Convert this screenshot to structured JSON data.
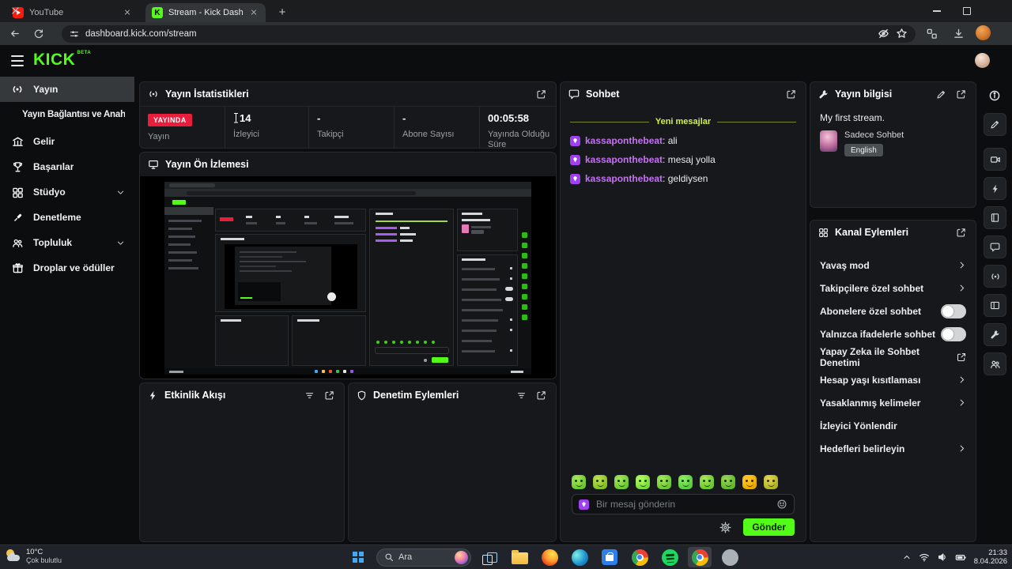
{
  "browser": {
    "tabs": [
      {
        "title": "YouTube"
      },
      {
        "title": "Stream - Kick Dashboard",
        "favicon_text": "K"
      }
    ],
    "new_tab_label": "+",
    "url": "dashboard.kick.com/stream"
  },
  "header": {
    "logo": "KICK",
    "beta": "BETA"
  },
  "sidebar": {
    "items": [
      {
        "label": "Yayın"
      },
      {
        "label": "Yayın Bağlantısı ve Anahtarı"
      },
      {
        "label": "Gelir"
      },
      {
        "label": "Başarılar"
      },
      {
        "label": "Stüdyo"
      },
      {
        "label": "Denetleme"
      },
      {
        "label": "Topluluk"
      },
      {
        "label": "Droplar ve ödüller"
      }
    ]
  },
  "stats": {
    "title": "Yayın İstatistikleri",
    "live_badge": "YAYINDA",
    "cols": [
      {
        "label": "Yayın"
      },
      {
        "value": "14",
        "label": "İzleyici"
      },
      {
        "value": "-",
        "label": "Takipçi"
      },
      {
        "value": "-",
        "label": "Abone Sayısı"
      },
      {
        "value": "00:05:58",
        "label": "Yayında Olduğu Süre"
      }
    ]
  },
  "preview": {
    "title": "Yayın Ön İzlemesi"
  },
  "activity_feed": {
    "title": "Etkinlik Akışı"
  },
  "mod_actions": {
    "title": "Denetim Eylemleri"
  },
  "chat": {
    "title": "Sohbet",
    "new_messages": "Yeni mesajlar",
    "separator": ": ",
    "messages": [
      {
        "user": "kassaponthebeat",
        "text": "ali"
      },
      {
        "user": "kassaponthebeat",
        "text": "mesaj yolla"
      },
      {
        "user": "kassaponthebeat",
        "text": "geldiysen"
      }
    ],
    "placeholder": "Bir mesaj gönderin",
    "send": "Gönder"
  },
  "stream_info": {
    "title": "Yayın bilgisi",
    "stream_title": "My first stream.",
    "category": "Sadece Sohbet",
    "language": "English"
  },
  "channel_actions": {
    "title": "Kanal Eylemleri",
    "items": [
      {
        "label": "Yavaş mod",
        "control": "chevron"
      },
      {
        "label": "Takipçilere özel sohbet",
        "control": "chevron"
      },
      {
        "label": "Abonelere özel sohbet",
        "control": "toggle-off"
      },
      {
        "label": "Yalnızca ifadelerle sohbet",
        "control": "toggle-off"
      },
      {
        "label": "Yapay Zeka ile Sohbet Denetimi",
        "control": "external-link"
      },
      {
        "label": "Hesap yaşı kısıtlaması",
        "control": "chevron"
      },
      {
        "label": "Yasaklanmış kelimeler",
        "control": "chevron"
      },
      {
        "label": "İzleyici Yönlendir",
        "control": "none"
      },
      {
        "label": "Hedefleri belirleyin",
        "control": "chevron"
      }
    ]
  },
  "taskbar": {
    "weather": {
      "temp": "10°C",
      "condition": "Çok bulutlu"
    },
    "search": "Ara",
    "clock": {
      "time": "21:33",
      "date": "8.04.2026"
    }
  },
  "colors": {
    "accent_green": "#53fc18",
    "live_red": "#ea1e3c",
    "chat_username": "#c573f2",
    "new_messages": "#d7f04a"
  },
  "icons": [
    "youtube-icon",
    "kick-icon",
    "back-icon",
    "reload-icon",
    "site-info-icon",
    "eye-off-icon",
    "star-icon",
    "tab-groups-icon",
    "download-icon",
    "menu-icon",
    "broadcast-icon",
    "revenue-icon",
    "trophy-icon",
    "studio-icon",
    "gavel-icon",
    "users-icon",
    "gift-icon",
    "chevron-down-icon",
    "expand-icon",
    "filter-icon",
    "monitor-icon",
    "lightning-icon",
    "shield-icon",
    "chat-icon",
    "wrench-icon",
    "pencil-icon",
    "grid-icon",
    "gear-icon",
    "smiley-icon",
    "chevron-right-icon",
    "external-link-icon",
    "info-icon",
    "camera-icon",
    "notebook-icon",
    "layout-icon",
    "windows-start-icon",
    "search-icon",
    "chevron-up-icon",
    "wifi-icon",
    "volume-icon",
    "battery-icon"
  ]
}
